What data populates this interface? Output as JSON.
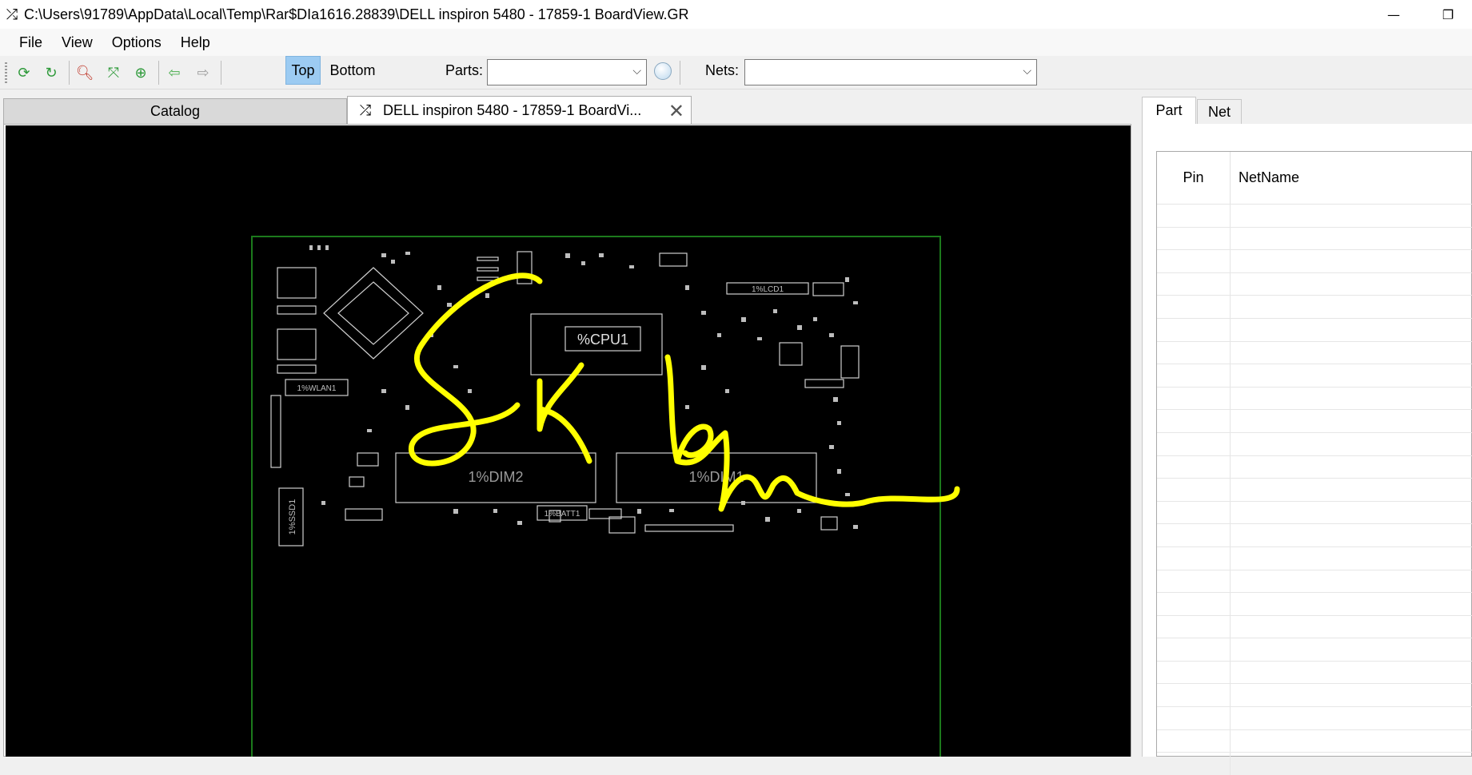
{
  "window": {
    "title": "C:\\Users\\91789\\AppData\\Local\\Temp\\Rar$DIa1616.28839\\DELL inspiron 5480 - 17859-1 BoardView.GR",
    "app_icon": "shuffle-icon",
    "controls": [
      "minimize-icon",
      "restore-icon"
    ]
  },
  "menu": {
    "file": "File",
    "view": "View",
    "options": "Options",
    "help": "Help"
  },
  "toolbar": {
    "icons": [
      "refresh-icon",
      "rotate-icon",
      "zoom-out-icon",
      "fit-icon",
      "zoom-in-icon",
      "back-arrow-icon",
      "forward-arrow-icon"
    ],
    "top_label": "Top",
    "bottom_label": "Bottom",
    "top_active": true,
    "parts_label": "Parts:",
    "parts_value": "",
    "nets_label": "Nets:",
    "nets_value": "",
    "bulb_icon": "lightbulb-icon"
  },
  "tabs": {
    "catalog": "Catalog",
    "board": "DELL inspiron 5480 - 17859-1 BoardVi..."
  },
  "board": {
    "labels": {
      "cpu": "%CPU1",
      "wlan": "1%WLAN1",
      "ssd": "1%SSD1",
      "batt": "1%BATT1",
      "dimm2": "1%DIM2",
      "dimm1": "1%DIM1",
      "lcd": "1%LCD1"
    },
    "outline_color": "#1c7a1c",
    "component_color": "#cfcfcf",
    "annotation_color": "#ffff00"
  },
  "right_panel": {
    "tab_part": "Part",
    "tab_net": "Net",
    "col_pin": "Pin",
    "col_netname": "NetName",
    "rows": 25
  }
}
